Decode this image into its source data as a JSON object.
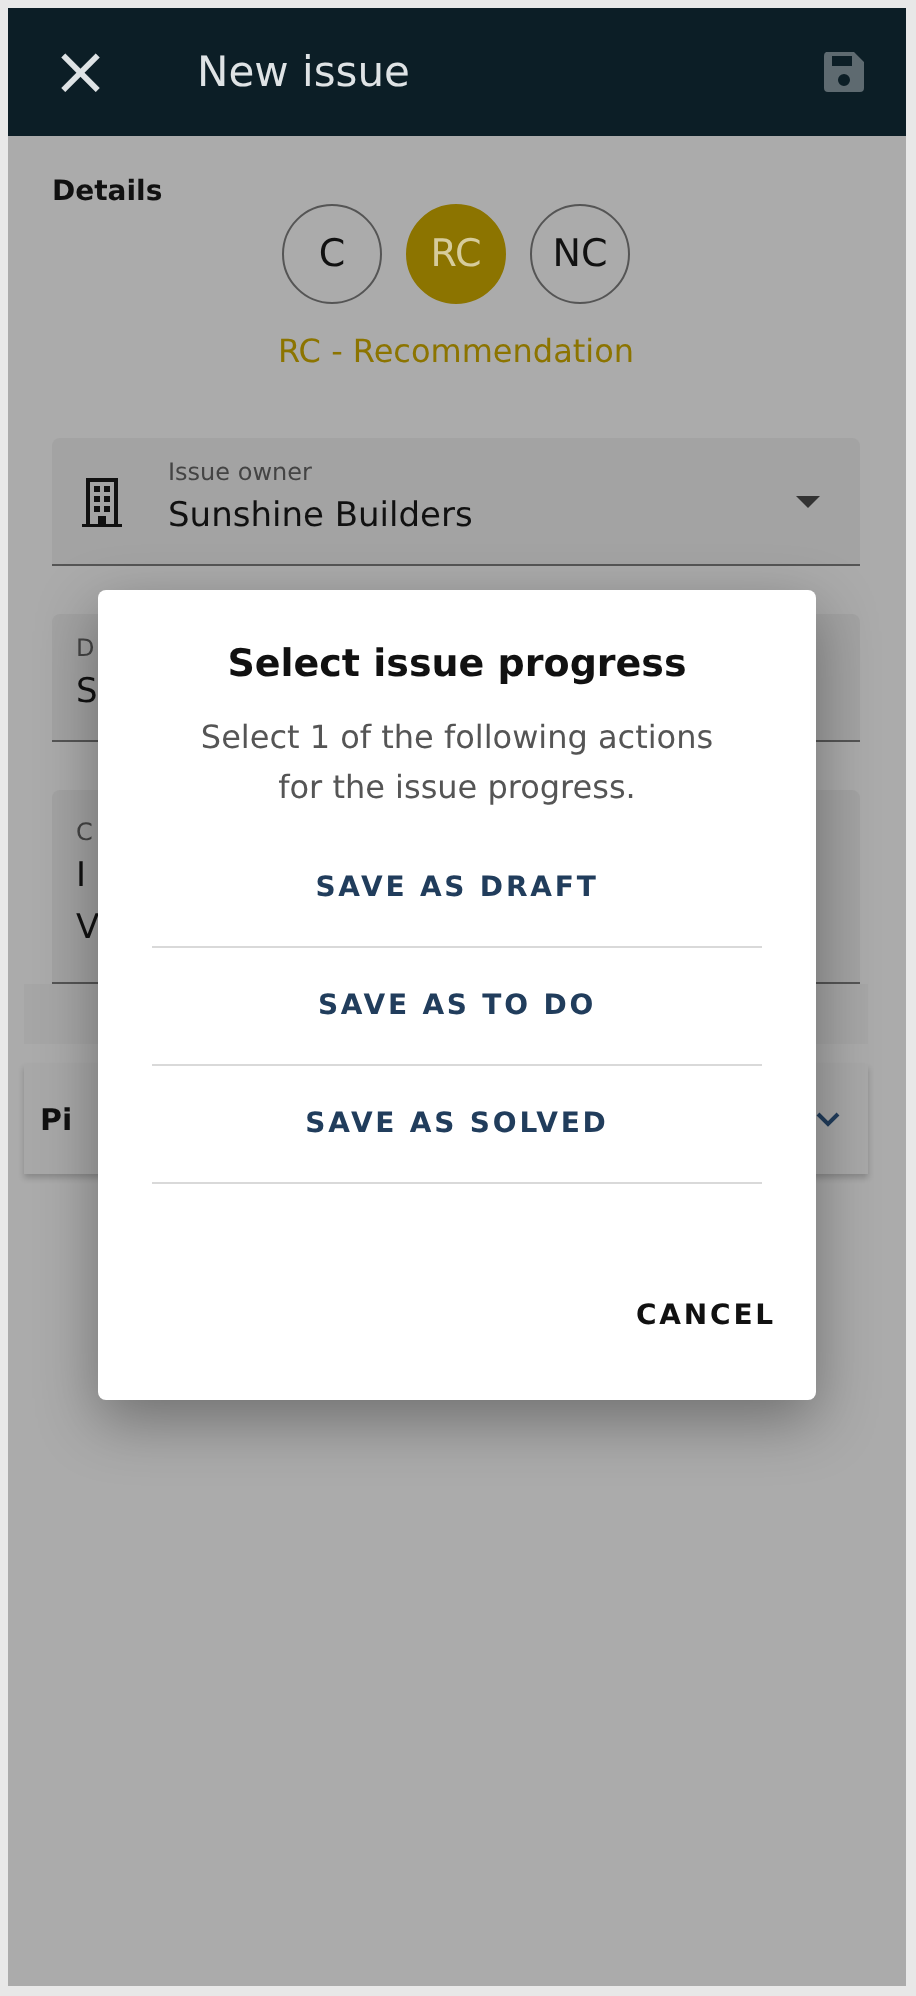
{
  "app_bar": {
    "close": "×",
    "title": "New issue"
  },
  "details": {
    "heading": "Details",
    "categories": [
      {
        "label": "C",
        "selected": false
      },
      {
        "label": "RC",
        "selected": true
      },
      {
        "label": "NC",
        "selected": false
      }
    ],
    "category_caption": "RC - Recommendation"
  },
  "fields": [
    {
      "label": "Issue owner",
      "value": "Sunshine Builders"
    },
    {
      "label": "D",
      "value": "S"
    },
    {
      "label": "C",
      "value": "I\nV"
    }
  ],
  "section": {
    "title": "Pi"
  },
  "dialog": {
    "title": "Select issue progress",
    "message": "Select 1 of the following actions for the issue progress.",
    "actions": [
      "SAVE AS DRAFT",
      "SAVE AS TO DO",
      "SAVE AS SOLVED"
    ],
    "cancel": "CANCEL"
  }
}
